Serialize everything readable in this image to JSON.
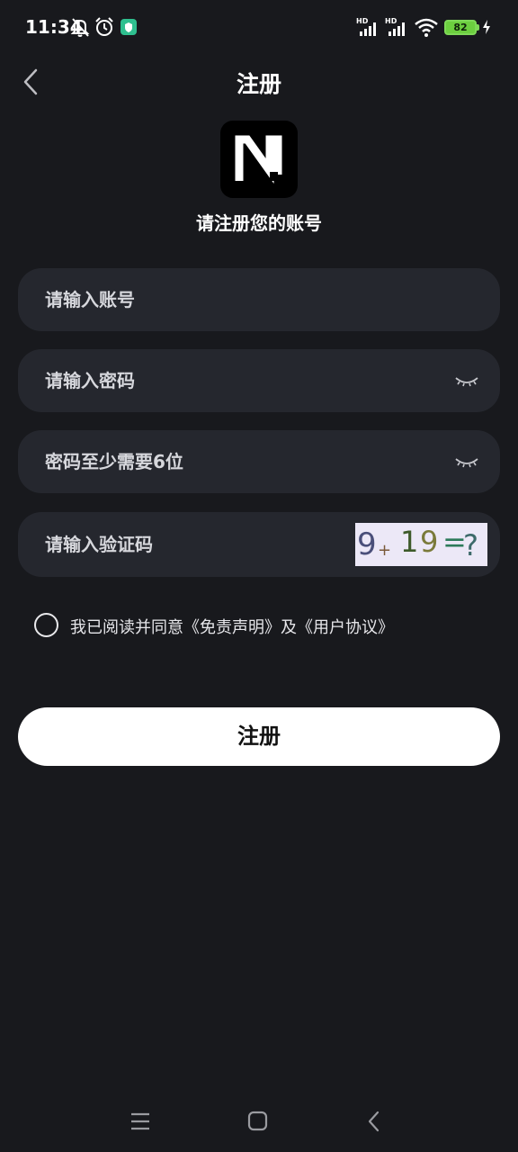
{
  "status_bar": {
    "time": "11:34",
    "battery": "82",
    "icons": [
      "mute-bell-icon",
      "alarm-icon",
      "vpn-shield-icon",
      "hd-signal-icon",
      "hd-signal-icon",
      "wifi-icon",
      "charging-icon"
    ]
  },
  "header": {
    "title": "注册",
    "back_icon": "chevron-left-icon"
  },
  "logo": {
    "letter": "N"
  },
  "subtitle": "请注册您的账号",
  "form": {
    "account_placeholder": "请输入账号",
    "password_placeholder": "请输入密码",
    "confirm_placeholder": "密码至少需要6位",
    "captcha_placeholder": "请输入验证码",
    "captcha_text": [
      "9",
      "+",
      "1",
      "9",
      "=",
      "?"
    ]
  },
  "agreement": {
    "prefix": "我已阅读并同意",
    "disclaimer": "《免责声明》",
    "joiner": "及",
    "user_agreement": "《用户协议》"
  },
  "submit_label": "注册",
  "colors": {
    "background": "#18191d",
    "field": "#25272e",
    "battery": "#6ccf3f"
  }
}
